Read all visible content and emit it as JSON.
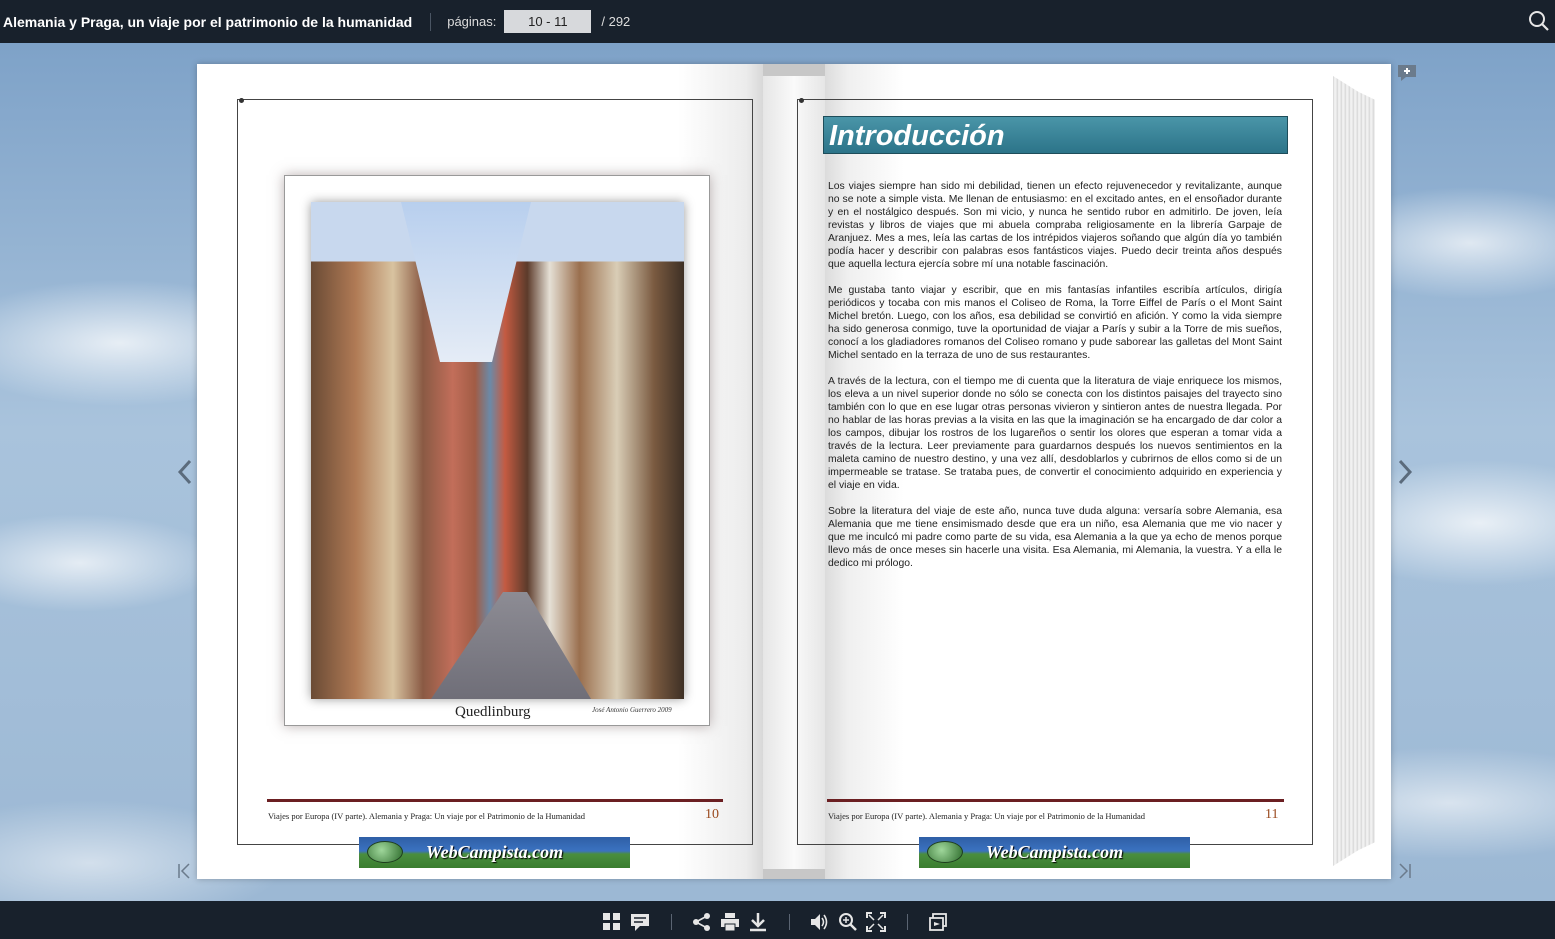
{
  "topbar": {
    "title": "Alemania y Praga, un viaje por el patrimonio de la humanidad",
    "pages_label": "páginas:",
    "page_value": "10 - 11",
    "page_total": "/  292",
    "search_icon": "search-icon"
  },
  "left_page": {
    "photo_caption": "Quedlinburg",
    "photo_credit": "José Antonio Guerrero 2009",
    "footer_text": "Viajes por Europa (IV parte).  Alemania y Praga: Un viaje por el Patrimonio de la Humanidad",
    "page_number": "10",
    "banner": "WebCampista.com"
  },
  "right_page": {
    "heading": "Introducción",
    "paragraphs": [
      "Los viajes siempre han sido mi debilidad, tienen un efecto rejuvenecedor y revitalizante, aunque no se note a simple vista. Me llenan de entusiasmo: en el excitado antes, en el ensoñador durante y en el nostálgico después. Son mi vicio, y nunca he sentido rubor en admitirlo. De joven, leía revistas y libros de viajes que mi abuela compraba religiosamente en la librería Garpaje de Aranjuez. Mes a mes, leía las cartas de los intrépidos viajeros soñando que algún día yo también podía hacer y describir con palabras esos fantásticos viajes. Puedo decir treinta años después que aquella lectura ejercía sobre mí una notable fascinación.",
      "Me gustaba tanto viajar y escribir, que en mis fantasías infantiles escribía artículos, dirigía periódicos y tocaba con mis manos el Coliseo de Roma, la Torre Eiffel de París o el Mont Saint Michel bretón. Luego, con los años, esa debilidad se convirtió en afición. Y como la vida siempre ha sido generosa conmigo, tuve la oportunidad de viajar a París y subir a la Torre de mis sueños, conocí a los gladiadores romanos del Coliseo romano y pude saborear las galletas del Mont Saint Michel sentado en la terraza de uno de sus restaurantes.",
      "A través de la lectura, con el tiempo me di cuenta que la literatura de viaje enriquece los mismos, los eleva a un nivel superior donde no sólo se conecta con los distintos paisajes del trayecto sino también con lo que en ese lugar otras personas vivieron y sintieron antes de nuestra llegada. Por no hablar de las horas previas a la visita en las que la imaginación se ha encargado de dar color a los campos, dibujar los rostros de los lugareños o sentir los olores que esperan a tomar vida a través de la lectura. Leer previamente para guardarnos después los nuevos sentimientos en la maleta camino de nuestro destino, y una vez allí, desdoblarlos y cubrirnos de ellos como si de un impermeable se tratase. Se trataba pues, de convertir el conocimiento adquirido en experiencia y el viaje en vida.",
      "Sobre la literatura del viaje de este año, nunca tuve duda alguna: versaría sobre Alemania, esa Alemania que me tiene ensimismado desde que era un niño, esa Alemania que me vio nacer y que me inculcó mi padre como parte de su vida, esa Alemania a la que ya echo de menos porque llevo más de once meses sin hacerle una visita. Esa Alemania, mi Alemania, la vuestra. Y a ella le dedico mi prólogo."
    ],
    "footer_text": "Viajes por Europa (IV parte).  Alemania y Praga: Un viaje por el Patrimonio de la Humanidad",
    "page_number": "11",
    "banner": "WebCampista.com"
  },
  "toolbar": {
    "icons": [
      "thumbnails-icon",
      "comments-icon",
      "share-icon",
      "print-icon",
      "download-icon",
      "sound-icon",
      "zoom-icon",
      "fullscreen-icon",
      "pages-icon"
    ]
  },
  "colors": {
    "bar_bg": "#18212c",
    "heading_bg": "#3a8599",
    "footer_rule": "#6b1f22",
    "page_number": "#9a4a1e"
  }
}
